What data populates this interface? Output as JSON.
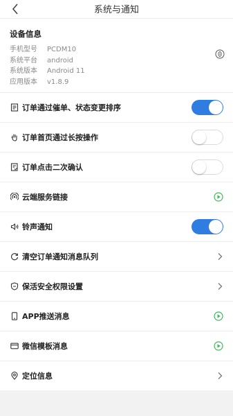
{
  "header": {
    "title": "系统与通知"
  },
  "device": {
    "title": "设备信息",
    "rows": [
      {
        "key": "手机型号",
        "value": "PCDM10"
      },
      {
        "key": "系统平台",
        "value": "android"
      },
      {
        "key": "系统版本",
        "value": "Android 11"
      },
      {
        "key": "应用版本",
        "value": "v1.8.9"
      }
    ]
  },
  "settings": [
    {
      "label": "订单通过催单、状态变更排序",
      "icon": "receipt-icon",
      "control": "toggle",
      "state": "on"
    },
    {
      "label": "订单首页通过长按操作",
      "icon": "hand-icon",
      "control": "toggle",
      "state": "off"
    },
    {
      "label": "订单点击二次确认",
      "icon": "confirm-doc-icon",
      "control": "toggle",
      "state": "off"
    },
    {
      "label": "云端服务链接",
      "icon": "cloud-link-icon",
      "control": "play"
    },
    {
      "label": "铃声通知",
      "icon": "speaker-icon",
      "control": "toggle",
      "state": "on"
    },
    {
      "label": "清空订单通知消息队列",
      "icon": "refresh-icon",
      "control": "chevron"
    },
    {
      "label": "保活安全权限设置",
      "icon": "shield-icon",
      "control": "chevron"
    },
    {
      "label": "APP推送消息",
      "icon": "phone-icon",
      "control": "play"
    },
    {
      "label": "微信模板消息",
      "icon": "card-icon",
      "control": "play"
    },
    {
      "label": "定位信息",
      "icon": "location-icon",
      "control": "chevron"
    }
  ],
  "colors": {
    "accent": "#2f7de0",
    "play": "#3cb95b"
  }
}
